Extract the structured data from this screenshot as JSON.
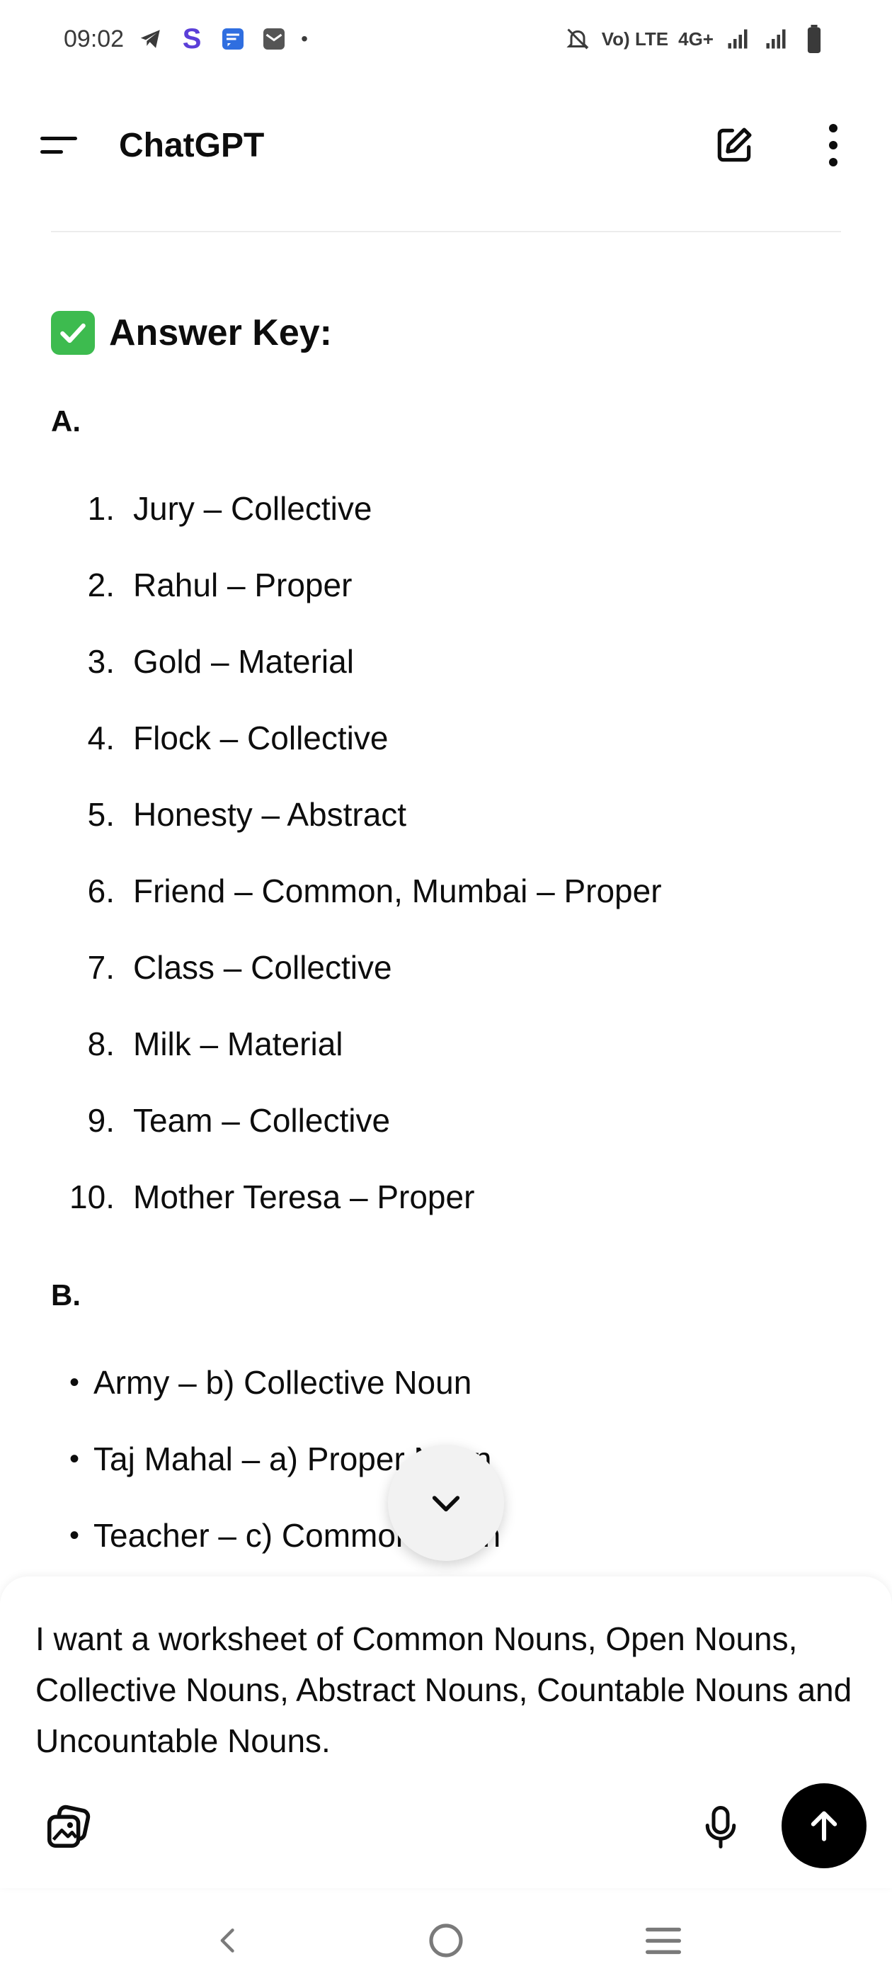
{
  "status_bar": {
    "time": "09:02",
    "s_app_letter": "S",
    "dot": "•",
    "volte_label": "Vo) LTE",
    "network_label": "4G+"
  },
  "app_bar": {
    "title": "ChatGPT"
  },
  "answer_key": {
    "check_mark": "✓",
    "heading": "Answer Key:",
    "section_a": {
      "label": "A.",
      "items": [
        {
          "num": "1.",
          "text": "Jury – Collective"
        },
        {
          "num": "2.",
          "text": "Rahul – Proper"
        },
        {
          "num": "3.",
          "text": "Gold – Material"
        },
        {
          "num": "4.",
          "text": "Flock – Collective"
        },
        {
          "num": "5.",
          "text": "Honesty – Abstract"
        },
        {
          "num": "6.",
          "text": "Friend – Common, Mumbai – Proper"
        },
        {
          "num": "7.",
          "text": "Class – Collective"
        },
        {
          "num": "8.",
          "text": "Milk – Material"
        },
        {
          "num": "9.",
          "text": "Team – Collective"
        },
        {
          "num": "10.",
          "text": "Mother Teresa – Proper"
        }
      ]
    },
    "section_b": {
      "label": "B.",
      "bullet": "•",
      "items": [
        {
          "text": "Army – b) Collective Noun"
        },
        {
          "text": "Taj Mahal – a) Proper Noun"
        },
        {
          "text": "Teacher – c) Common Noun"
        }
      ]
    }
  },
  "composer": {
    "message": "I want a worksheet of Common Nouns, Open Nouns, Collective Nouns, Abstract Nouns, Countable Nouns and Uncountable Nouns."
  },
  "icons": {
    "menu": "menu-icon",
    "new_chat": "edit-icon",
    "more": "more-vertical-icon",
    "scroll_down": "chevron-down-icon",
    "attach": "image-gallery-icon",
    "mic": "microphone-icon",
    "send": "arrow-up-icon",
    "nav_back": "back-icon",
    "nav_home": "home-icon",
    "nav_recents": "recents-icon"
  },
  "colors": {
    "accent_check": "#3dbb4f",
    "send_button": "#000000",
    "s_app": "#5b3fd8",
    "msg_app": "#2f6ee0"
  }
}
